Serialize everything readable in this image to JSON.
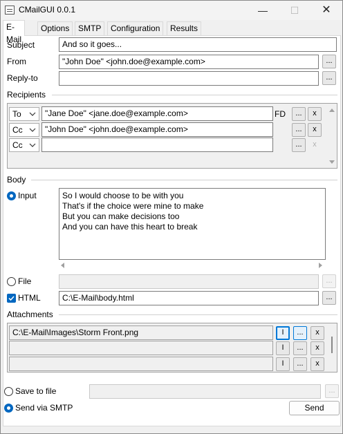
{
  "window": {
    "title": "CMailGUI 0.0.1",
    "minimize": "—",
    "maximize": "☐",
    "close": "✕"
  },
  "tabs": [
    "E-Mail",
    "Options",
    "SMTP",
    "Configuration",
    "Results"
  ],
  "email": {
    "subject_label": "Subject",
    "subject_value": "And so it goes...",
    "from_label": "From",
    "from_value": "\"John Doe\" <john.doe@example.com>",
    "replyto_label": "Reply-to",
    "replyto_value": "",
    "browse": "...",
    "remove": "x",
    "fd_label": "FD",
    "recipients_label": "Recipients",
    "recipients": [
      {
        "type": "To",
        "address": "\"Jane Doe\" <jane.doe@example.com>"
      },
      {
        "type": "Cc",
        "address": "\"John Doe\" <john.doe@example.com>"
      },
      {
        "type": "Cc",
        "address": ""
      }
    ],
    "body_label": "Body",
    "input_label": "Input",
    "body_lines": [
      "So I would choose to be with you",
      "That's if the choice were mine to make",
      "But you can make decisions too",
      "And you can have this heart to break"
    ],
    "file_label": "File",
    "file_value": "",
    "html_label": "HTML",
    "html_value": "C:\\E-Mail\\body.html",
    "attachments_label": "Attachments",
    "inline_btn": "I",
    "attachments": [
      "C:\\E-Mail\\Images\\Storm Front.png",
      "",
      ""
    ],
    "save_label": "Save to file",
    "save_value": "",
    "smtp_label": "Send via SMTP",
    "send_label": "Send"
  },
  "colors": {
    "accent": "#0067c0",
    "focus": "#0078d7"
  }
}
